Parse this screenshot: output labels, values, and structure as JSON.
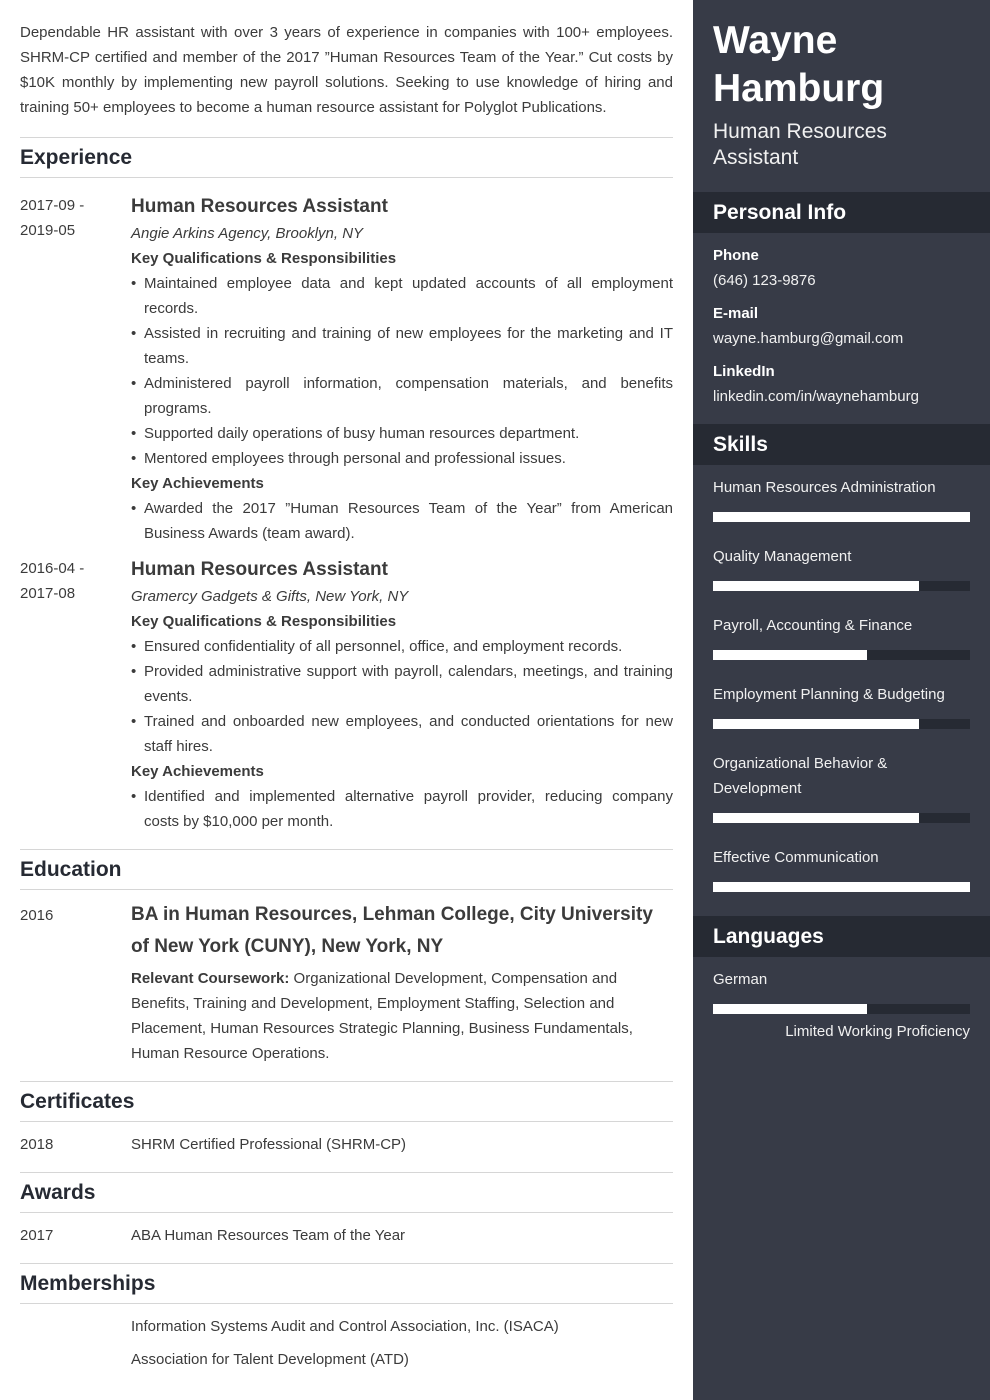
{
  "summary": "Dependable HR assistant with over 3 years of experience in companies with 100+ employees. SHRM-CP certified and member of the 2017 ”Human Resources Team of the Year.” Cut costs by $10K monthly by implementing new payroll solutions. Seeking to use knowledge of hiring and training 50+ employees to become a human resource assistant for Polyglot Publications.",
  "experience": {
    "title": "Experience",
    "jobs": [
      {
        "date_start": "2017-09 -",
        "date_end": "2019-05",
        "title": "Human Resources Assistant",
        "company": "Angie Arkins Agency, Brooklyn, NY",
        "resp_label": "Key Qualifications & Responsibilities",
        "responsibilities": [
          "Maintained employee data and kept updated accounts of all employment records.",
          "Assisted in recruiting and training of new employees for the marketing and IT teams.",
          "Administered payroll information, compensation materials, and benefits programs.",
          "Supported daily operations of busy human resources department.",
          "Mentored employees through personal and professional issues."
        ],
        "ach_label": "Key Achievements",
        "achievements": [
          "Awarded the 2017 ”Human Resources Team of the Year” from American Business Awards (team award)."
        ]
      },
      {
        "date_start": "2016-04 -",
        "date_end": "2017-08",
        "title": "Human Resources Assistant",
        "company": "Gramercy Gadgets & Gifts, New York, NY",
        "resp_label": "Key Qualifications & Responsibilities",
        "responsibilities": [
          "Ensured confidentiality of all personnel, office, and employment records.",
          "Provided administrative support with payroll, calendars, meetings, and training events.",
          "Trained and onboarded new employees, and conducted orientations for new staff hires."
        ],
        "ach_label": "Key Achievements",
        "achievements": [
          "Identified and implemented alternative payroll provider, reducing company costs by $10,000 per month."
        ]
      }
    ]
  },
  "education": {
    "title": "Education",
    "date": "2016",
    "degree": "BA in Human Resources, Lehman College, City University of New York (CUNY), New York, NY",
    "coursework_label": "Relevant Coursework:",
    "coursework": " Organizational Development, Compensation and Benefits, Training and Development, Employment Staffing, Selection and Placement, Human Resources Strategic Planning, Business Fundamentals, Human Resource Operations."
  },
  "certificates": {
    "title": "Certificates",
    "items": [
      {
        "date": "2018",
        "name": "SHRM Certified Professional (SHRM-CP)"
      }
    ]
  },
  "awards": {
    "title": "Awards",
    "items": [
      {
        "date": "2017",
        "name": "ABA Human Resources Team of the Year"
      }
    ]
  },
  "memberships": {
    "title": "Memberships",
    "items": [
      "Information Systems Audit and Control Association, Inc. (ISACA)",
      "Association for Talent Development (ATD)"
    ]
  },
  "sidebar": {
    "first_name": "Wayne",
    "last_name": "Hamburg",
    "role": "Human Resources Assistant",
    "personal_info": {
      "title": "Personal Info",
      "phone_label": "Phone",
      "phone": "(646) 123-9876",
      "email_label": "E-mail",
      "email": "wayne.hamburg@gmail.com",
      "linkedin_label": "LinkedIn",
      "linkedin": "linkedin.com/in/waynehamburg"
    },
    "skills": {
      "title": "Skills",
      "items": [
        {
          "name": "Human Resources Administration",
          "level": 1.0
        },
        {
          "name": "Quality Management",
          "level": 0.8
        },
        {
          "name": "Payroll, Accounting & Finance",
          "level": 0.6
        },
        {
          "name": "Employment Planning & Budgeting",
          "level": 0.8
        },
        {
          "name": "Organizational Behavior & Development",
          "level": 0.8
        },
        {
          "name": "Effective Communication",
          "level": 1.0
        }
      ]
    },
    "languages": {
      "title": "Languages",
      "items": [
        {
          "name": "German",
          "level": 0.6,
          "level_label": "Limited Working Proficiency"
        }
      ]
    }
  },
  "colors": {
    "sidebar_bg": "#373b47",
    "sidebar_header_bg": "#262a33",
    "bar_fill": "#ffffff",
    "heading_text": "#262a33",
    "body_text": "#3b3b3b"
  }
}
